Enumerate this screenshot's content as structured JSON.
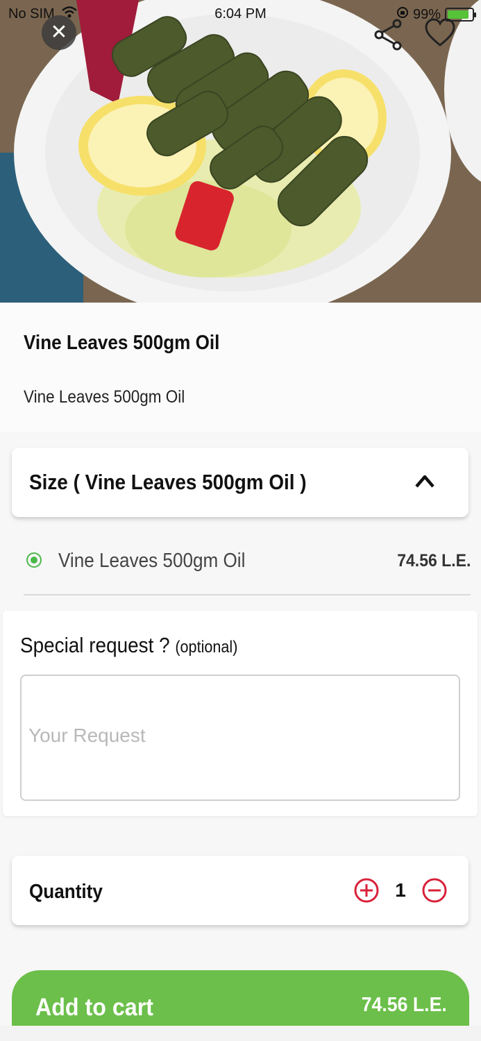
{
  "status_bar": {
    "carrier": "No SIM",
    "time": "6:04 PM",
    "battery_percent": "99%",
    "battery_level": 0.99,
    "icons": [
      "wifi-icon",
      "orientation-lock-icon",
      "battery-charging-icon"
    ]
  },
  "hero": {
    "image_description_icon": "food-photo",
    "close_icon": "close-icon",
    "share_icon": "share-icon",
    "favorite_icon": "heart-icon"
  },
  "product": {
    "title": "Vine Leaves 500gm Oil",
    "description": "Vine Leaves 500gm Oil"
  },
  "size_section": {
    "title": "Size ( Vine Leaves 500gm Oil )",
    "expanded": true,
    "options": [
      {
        "label": "Vine Leaves 500gm Oil",
        "price": "74.56 L.E.",
        "selected": true
      }
    ]
  },
  "special_request": {
    "label": "Special request ?",
    "optional_label": "(optional)",
    "placeholder": "Your Request",
    "value": ""
  },
  "quantity": {
    "label": "Quantity",
    "value": "1"
  },
  "cart_button": {
    "label": "Add to cart",
    "price": "74.56 L.E."
  },
  "colors": {
    "accent_green": "#6bbf4a",
    "radio_green": "#4cb848",
    "quantity_red": "#d9213a"
  }
}
